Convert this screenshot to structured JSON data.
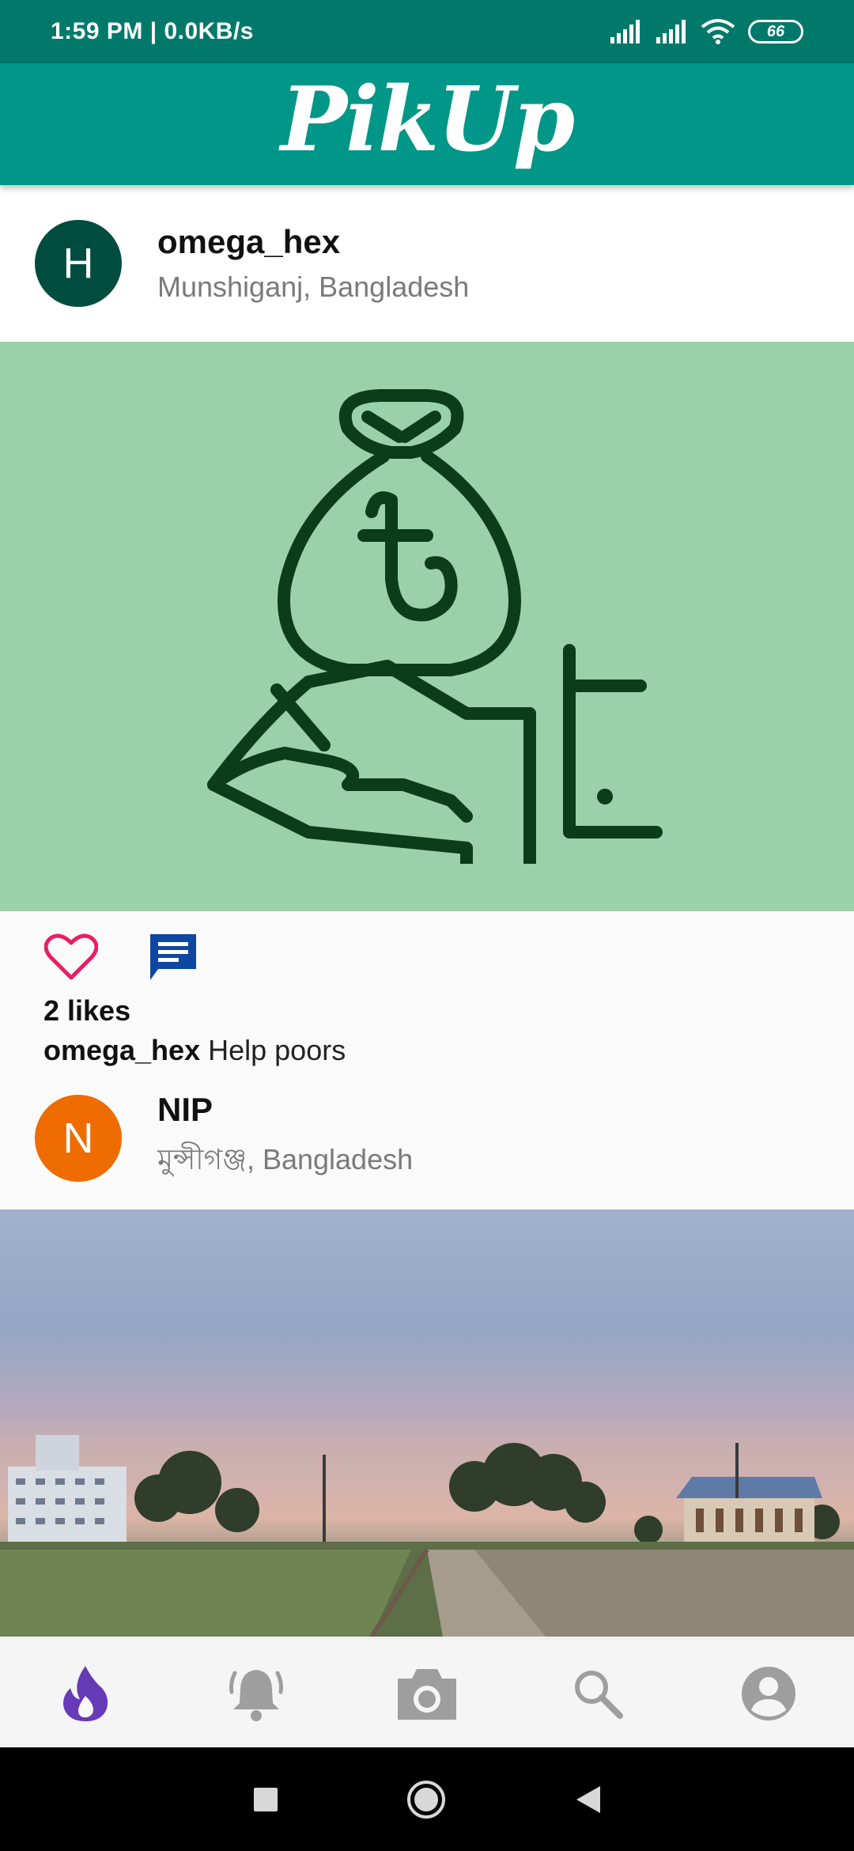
{
  "status_bar": {
    "time_speed": "1:59 PM | 0.0KB/s",
    "battery": "66"
  },
  "app_bar": {
    "title": "PikUp"
  },
  "posts": [
    {
      "avatar_letter": "H",
      "avatar_color": "#004d40",
      "username": "omega_hex",
      "location": "Munshiganj, Bangladesh",
      "likes": "2 likes",
      "caption_user": "omega_hex",
      "caption_text": "Help poors"
    },
    {
      "avatar_letter": "N",
      "avatar_color": "#ef6c00",
      "username": "NIP",
      "location": "মুন্সীগঞ্জ, Bangladesh"
    }
  ],
  "colors": {
    "status_bar": "#00796b",
    "app_bar": "#009688",
    "like_icon": "#e91e63",
    "comment_icon": "#0d47a1",
    "active_nav": "#673ab7",
    "inactive_nav": "#9e9e9e"
  },
  "bottom_nav": {
    "items": [
      "fire-icon",
      "bell-icon",
      "camera-icon",
      "search-icon",
      "account-icon"
    ],
    "active": "fire-icon"
  }
}
